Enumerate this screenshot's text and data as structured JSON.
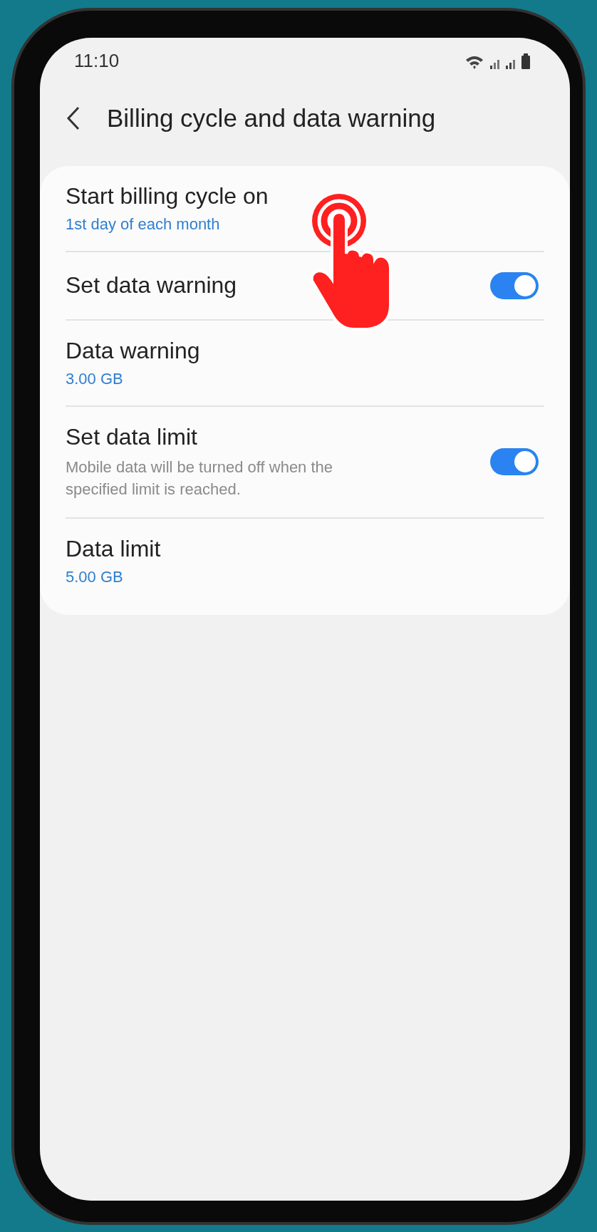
{
  "status_bar": {
    "time": "11:10"
  },
  "header": {
    "title": "Billing cycle and data warning"
  },
  "settings": [
    {
      "kind": "value",
      "title": "Start billing cycle on",
      "value": "1st day of each month"
    },
    {
      "kind": "switch",
      "title": "Set data warning",
      "on": true
    },
    {
      "kind": "value",
      "title": "Data warning",
      "value": "3.00 GB"
    },
    {
      "kind": "switch",
      "title": "Set data limit",
      "description": "Mobile data will be turned off when the specified limit is reached.",
      "on": true
    },
    {
      "kind": "value",
      "title": "Data limit",
      "value": "5.00 GB"
    }
  ]
}
